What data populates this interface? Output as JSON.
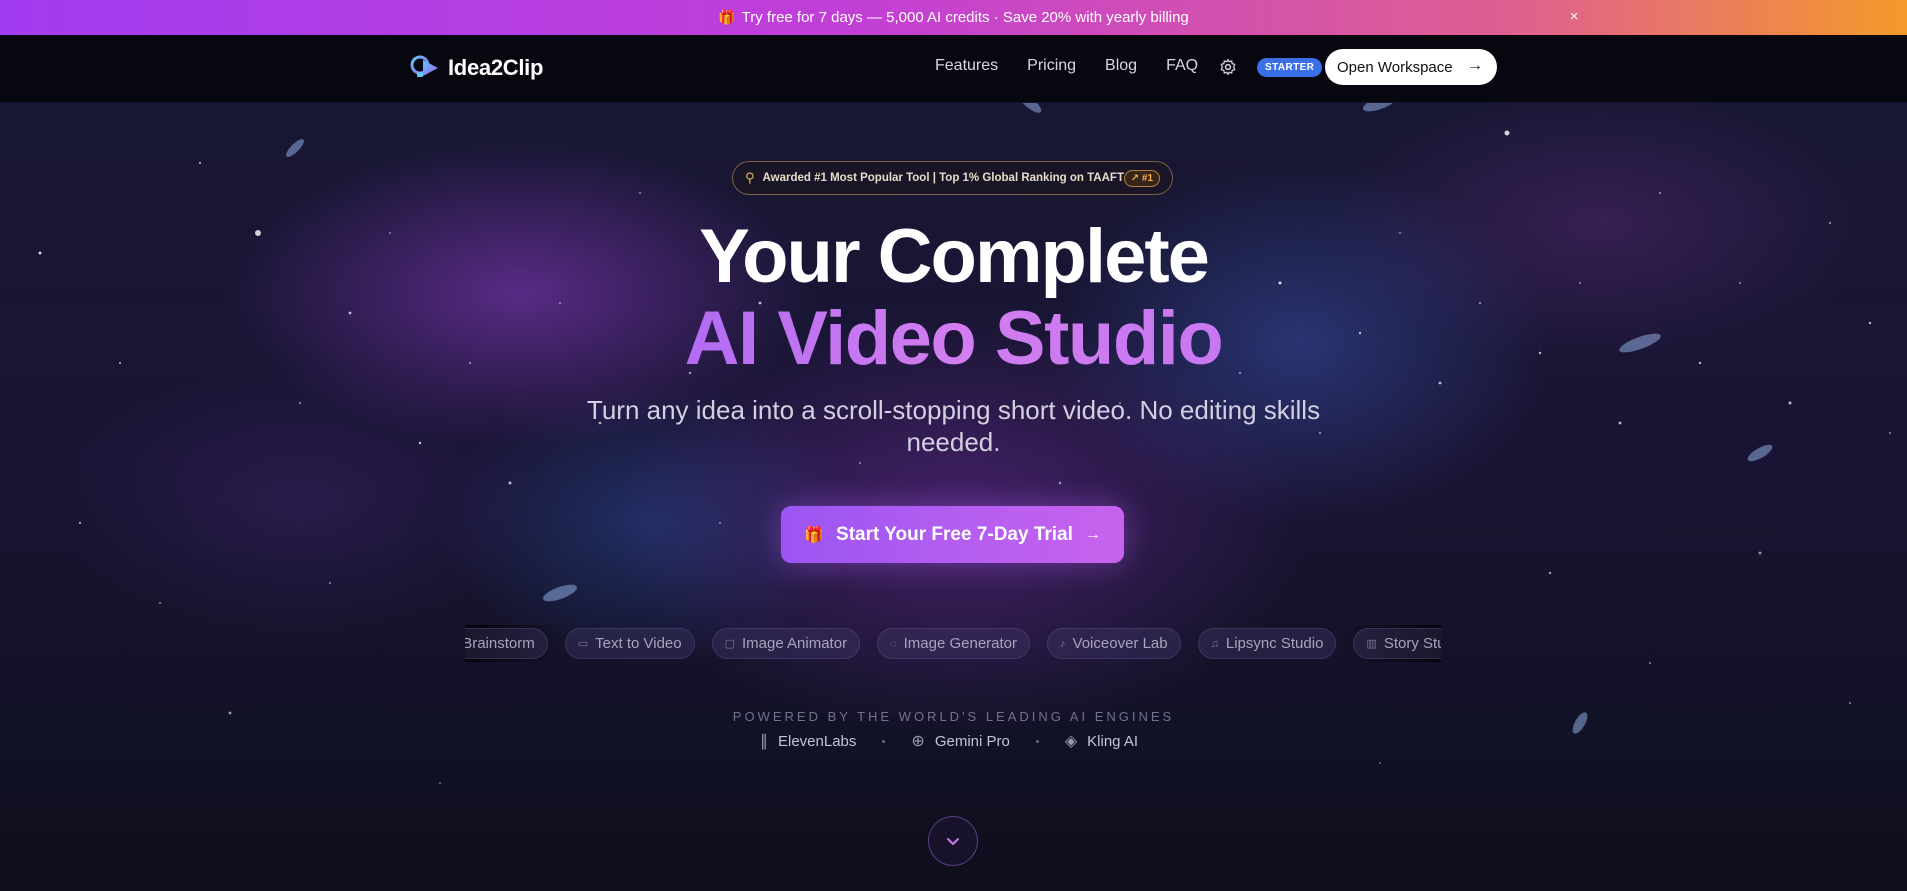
{
  "promo": {
    "text": "Try free for 7 days — 5,000 AI credits · Save 20% with yearly billing",
    "gift_icon": "gift-icon",
    "close": "×"
  },
  "nav": {
    "logo": "Idea2Clip",
    "links": [
      "Features",
      "Pricing",
      "Blog",
      "FAQ"
    ],
    "plan_badge": "STARTER",
    "workspace_label": "Open Workspace"
  },
  "hero": {
    "award_text": "Awarded #1 Most Popular Tool | Top 1% Global Ranking on TAAFT",
    "award_rank": "↗ #1",
    "title_line1": "Your Complete",
    "title_line2": "AI Video Studio",
    "subtitle": "Turn any idea into a scroll-stopping short video. No editing skills needed.",
    "cta_label": "Start Your Free 7-Day Trial",
    "tools": [
      "Brainstorm",
      "Text to Video",
      "Image Animator",
      "Image Generator",
      "Voiceover Lab",
      "Lipsync Studio",
      "Story Studio"
    ],
    "powered_by": "POWERED BY THE WORLD'S LEADING AI ENGINES",
    "engines": [
      "ElevenLabs",
      "Gemini Pro",
      "Kling AI"
    ]
  },
  "colors": {
    "accent": "#b35df0",
    "badge": "#3b6fe8",
    "award_gold": "#e3b55a"
  }
}
